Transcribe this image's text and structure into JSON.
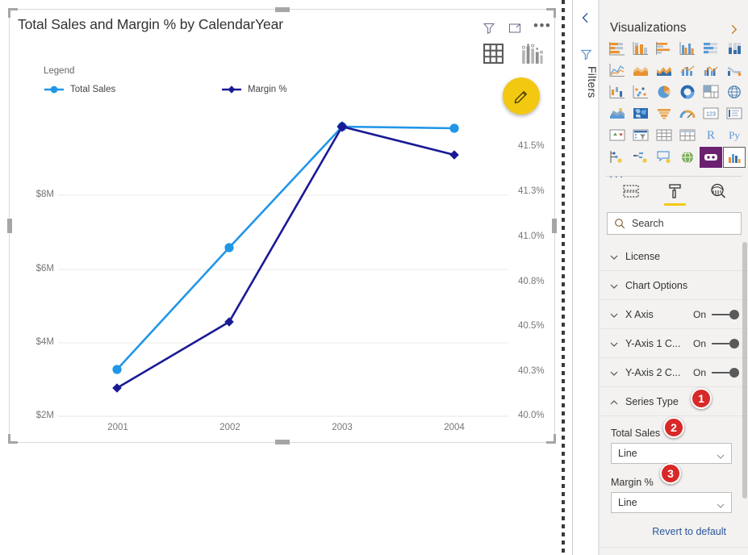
{
  "visual": {
    "title": "Total Sales and Margin % by CalendarYear",
    "legend_title": "Legend",
    "header_icons": [
      "filter-icon",
      "focus-mode-icon",
      "more-options-icon"
    ],
    "tool_icons": [
      "table-grid-icon",
      "bar-chart-icon"
    ],
    "fab_icon": "pencil-icon"
  },
  "chart_data": {
    "type": "line",
    "title": "Total Sales and Margin % by CalendarYear",
    "xlabel": "",
    "categories": [
      "2001",
      "2002",
      "2003",
      "2004"
    ],
    "grid": true,
    "legend_position": "top-left",
    "series": [
      {
        "name": "Total Sales",
        "axis": "left",
        "color": "#2196e8",
        "marker": "circle",
        "values": [
          3150000,
          6450000,
          9150000,
          9150000
        ]
      },
      {
        "name": "Margin %",
        "axis": "right",
        "color": "#1a1a96",
        "marker": "diamond",
        "values": [
          40.22,
          40.64,
          41.72,
          41.62
        ]
      }
    ],
    "y_left": {
      "label": "",
      "ticks": [
        "$2M",
        "$4M",
        "$6M",
        "$8M"
      ],
      "tick_values": [
        2000000,
        4000000,
        6000000,
        8000000
      ],
      "ylim": [
        2000000,
        10000000
      ]
    },
    "y_right": {
      "label": "",
      "ticks": [
        "40.0%",
        "40.3%",
        "40.5%",
        "40.8%",
        "41.0%",
        "41.3%",
        "41.5%"
      ],
      "tick_values": [
        40.0,
        40.3,
        40.5,
        40.8,
        41.0,
        41.3,
        41.5
      ],
      "ylim": [
        40.0,
        41.8
      ]
    }
  },
  "filters_rail": {
    "collapse_icon": "chevron-left-icon",
    "funnel_icon": "filter-icon",
    "label": "Filters"
  },
  "viz_pane": {
    "title": "Visualizations",
    "expand_icon": "chevron-right-icon",
    "more_label": "...",
    "gallery": [
      "stacked-bar-chart",
      "stacked-column-chart",
      "clustered-bar-chart",
      "clustered-column-chart",
      "100-stacked-bar-chart",
      "100-stacked-column-chart",
      "line-chart",
      "area-chart",
      "stacked-area-chart",
      "line-and-stacked-column-chart",
      "line-and-clustered-column-chart",
      "ribbon-chart",
      "waterfall-chart",
      "scatter-chart",
      "pie-chart",
      "donut-chart",
      "treemap",
      "map",
      "filled-map",
      "shape-map",
      "funnel",
      "gauge",
      "card",
      "multi-row-card",
      "kpi",
      "slicer",
      "table",
      "matrix",
      "r-script-visual",
      "python-visual",
      "key-influencers",
      "decomposition-tree",
      "qa-visual",
      "arcgis-maps",
      "paginated-report",
      "custom-combo-chart"
    ],
    "selected_index": 35,
    "tabs": [
      {
        "name": "fields",
        "icon": "fields-icon",
        "active": false
      },
      {
        "name": "format",
        "icon": "paint-roller-icon",
        "active": true
      },
      {
        "name": "analytics",
        "icon": "analytics-magnifier-icon",
        "active": false
      }
    ],
    "search": {
      "placeholder": "Search",
      "value": "",
      "icon": "search-icon"
    },
    "properties": [
      {
        "name": "License",
        "expanded": false,
        "toggle": null
      },
      {
        "name": "Chart Options",
        "expanded": false,
        "toggle": null
      },
      {
        "name": "X Axis",
        "expanded": false,
        "toggle": "On"
      },
      {
        "name": "Y-Axis 1 C...",
        "expanded": false,
        "toggle": "On"
      },
      {
        "name": "Y-Axis 2 C...",
        "expanded": false,
        "toggle": "On"
      },
      {
        "name": "Series Type",
        "expanded": true,
        "toggle": null
      }
    ],
    "series_type": {
      "fields": [
        {
          "label": "Total Sales",
          "value": "Line"
        },
        {
          "label": "Margin %",
          "value": "Line"
        }
      ],
      "revert_label": "Revert to default"
    }
  },
  "callouts": [
    {
      "id": "1",
      "target": "series-type-section"
    },
    {
      "id": "2",
      "target": "total-sales-field"
    },
    {
      "id": "3",
      "target": "margin-pct-field"
    }
  ]
}
